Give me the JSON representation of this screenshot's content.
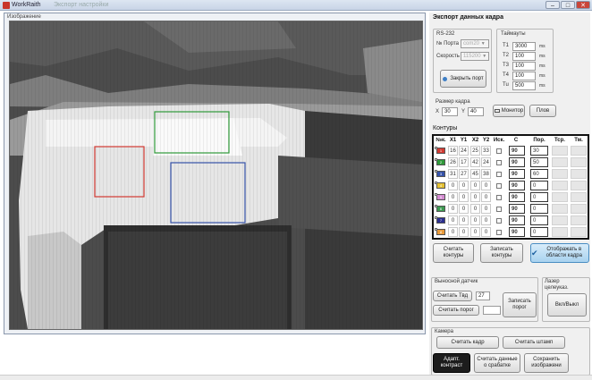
{
  "window": {
    "title": "WorkRaith",
    "faded_title": "Экспорт настройки",
    "buttons": {
      "minimize": "–",
      "maximize": "□",
      "close": "✕"
    }
  },
  "image_panel": {
    "label": "Изображение",
    "rect_colors": {
      "red": "#d23a32",
      "green": "#2f9a3a",
      "blue": "#3552a8"
    }
  },
  "export": {
    "header": "Экспорт данных кадра",
    "rs232": {
      "group_label": "RS-232",
      "port_label": "№ Порта",
      "port_value": "com20",
      "speed_label": "Скорость",
      "speed_value": "115200",
      "close_port": "Закрыть порт"
    },
    "timeouts": {
      "group_label": "Таймауты",
      "items": [
        {
          "label": "T1",
          "value": "3000",
          "unit": "ms"
        },
        {
          "label": "T2",
          "value": "100",
          "unit": "ms"
        },
        {
          "label": "T3",
          "value": "100",
          "unit": "ms"
        },
        {
          "label": "T4",
          "value": "100",
          "unit": "ms"
        },
        {
          "label": "Tu",
          "value": "500",
          "unit": "ms"
        }
      ]
    },
    "frame_size": {
      "group_label": "Размер кадра",
      "x_label": "X",
      "x_value": "30",
      "y_label": "Y",
      "y_value": "40",
      "monitor_label": "Монитор",
      "stop_label": "Плов"
    }
  },
  "contours": {
    "header": "Контуры",
    "columns": [
      "№к.",
      "X1",
      "Y1",
      "X2",
      "Y2",
      "Иск.",
      "C",
      "Пор.",
      "Тср.",
      "Тм."
    ],
    "rows": [
      {
        "id": "1",
        "color": "#d23a32",
        "x1": "16",
        "y1": "24",
        "x2": "25",
        "y2": "33",
        "c": "90",
        "por": "30"
      },
      {
        "id": "2",
        "color": "#2f9a3a",
        "x1": "26",
        "y1": "17",
        "x2": "42",
        "y2": "24",
        "c": "90",
        "por": "50"
      },
      {
        "id": "3",
        "color": "#3552a8",
        "x1": "31",
        "y1": "27",
        "x2": "45",
        "y2": "38",
        "c": "90",
        "por": "60"
      },
      {
        "id": "4",
        "color": "#e4c032",
        "x1": "0",
        "y1": "0",
        "x2": "0",
        "y2": "0",
        "c": "90",
        "por": "0"
      },
      {
        "id": "5",
        "color": "#d38ad0",
        "x1": "0",
        "y1": "0",
        "x2": "0",
        "y2": "0",
        "c": "90",
        "por": "0"
      },
      {
        "id": "6",
        "color": "#3c9a50",
        "x1": "0",
        "y1": "0",
        "x2": "0",
        "y2": "0",
        "c": "90",
        "por": "0"
      },
      {
        "id": "7",
        "color": "#2b2f8f",
        "x1": "0",
        "y1": "0",
        "x2": "0",
        "y2": "0",
        "c": "90",
        "por": "0"
      },
      {
        "id": "8",
        "color": "#e89a3a",
        "x1": "0",
        "y1": "0",
        "x2": "0",
        "y2": "0",
        "c": "90",
        "por": "0"
      }
    ],
    "read_btn": "Считать контуры",
    "write_btn": "Записать контуры",
    "show_btn": "Отображать в области кадра"
  },
  "sensor": {
    "group_label": "Выносной датчик",
    "read_temp": "Считать Твд",
    "temp_value": "27",
    "read_threshold": "Считать порог",
    "threshold_value": "",
    "write_threshold": "Записать порог"
  },
  "laser": {
    "group_label": "Лазер целеуказ.",
    "toggle": "Вкл/Выкл"
  },
  "camera": {
    "group_label": "Камера",
    "read_frame": "Считать кадр",
    "read_stamp": "Считать штамп",
    "adapt_contrast": "Адапт. контраст",
    "read_trigger": "Считать данные о срабатке",
    "save_images": "Сохранить изображени"
  }
}
